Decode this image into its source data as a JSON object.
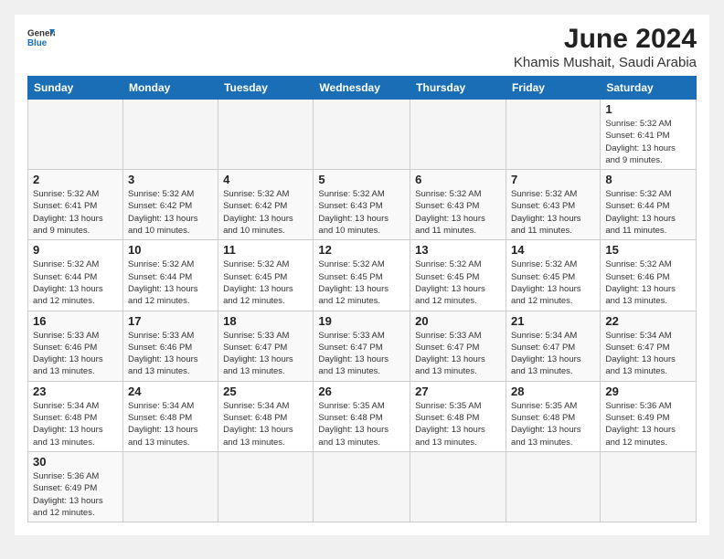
{
  "header": {
    "logo_general": "General",
    "logo_blue": "Blue",
    "month": "June 2024",
    "location": "Khamis Mushait, Saudi Arabia"
  },
  "days_of_week": [
    "Sunday",
    "Monday",
    "Tuesday",
    "Wednesday",
    "Thursday",
    "Friday",
    "Saturday"
  ],
  "weeks": [
    [
      {
        "day": "",
        "info": ""
      },
      {
        "day": "",
        "info": ""
      },
      {
        "day": "",
        "info": ""
      },
      {
        "day": "",
        "info": ""
      },
      {
        "day": "",
        "info": ""
      },
      {
        "day": "",
        "info": ""
      },
      {
        "day": "1",
        "info": "Sunrise: 5:32 AM\nSunset: 6:41 PM\nDaylight: 13 hours\nand 9 minutes."
      }
    ],
    [
      {
        "day": "2",
        "info": "Sunrise: 5:32 AM\nSunset: 6:41 PM\nDaylight: 13 hours\nand 9 minutes."
      },
      {
        "day": "3",
        "info": "Sunrise: 5:32 AM\nSunset: 6:42 PM\nDaylight: 13 hours\nand 10 minutes."
      },
      {
        "day": "4",
        "info": "Sunrise: 5:32 AM\nSunset: 6:42 PM\nDaylight: 13 hours\nand 10 minutes."
      },
      {
        "day": "5",
        "info": "Sunrise: 5:32 AM\nSunset: 6:43 PM\nDaylight: 13 hours\nand 10 minutes."
      },
      {
        "day": "6",
        "info": "Sunrise: 5:32 AM\nSunset: 6:43 PM\nDaylight: 13 hours\nand 11 minutes."
      },
      {
        "day": "7",
        "info": "Sunrise: 5:32 AM\nSunset: 6:43 PM\nDaylight: 13 hours\nand 11 minutes."
      },
      {
        "day": "8",
        "info": "Sunrise: 5:32 AM\nSunset: 6:44 PM\nDaylight: 13 hours\nand 11 minutes."
      }
    ],
    [
      {
        "day": "9",
        "info": "Sunrise: 5:32 AM\nSunset: 6:44 PM\nDaylight: 13 hours\nand 12 minutes."
      },
      {
        "day": "10",
        "info": "Sunrise: 5:32 AM\nSunset: 6:44 PM\nDaylight: 13 hours\nand 12 minutes."
      },
      {
        "day": "11",
        "info": "Sunrise: 5:32 AM\nSunset: 6:45 PM\nDaylight: 13 hours\nand 12 minutes."
      },
      {
        "day": "12",
        "info": "Sunrise: 5:32 AM\nSunset: 6:45 PM\nDaylight: 13 hours\nand 12 minutes."
      },
      {
        "day": "13",
        "info": "Sunrise: 5:32 AM\nSunset: 6:45 PM\nDaylight: 13 hours\nand 12 minutes."
      },
      {
        "day": "14",
        "info": "Sunrise: 5:32 AM\nSunset: 6:45 PM\nDaylight: 13 hours\nand 12 minutes."
      },
      {
        "day": "15",
        "info": "Sunrise: 5:32 AM\nSunset: 6:46 PM\nDaylight: 13 hours\nand 13 minutes."
      }
    ],
    [
      {
        "day": "16",
        "info": "Sunrise: 5:33 AM\nSunset: 6:46 PM\nDaylight: 13 hours\nand 13 minutes."
      },
      {
        "day": "17",
        "info": "Sunrise: 5:33 AM\nSunset: 6:46 PM\nDaylight: 13 hours\nand 13 minutes."
      },
      {
        "day": "18",
        "info": "Sunrise: 5:33 AM\nSunset: 6:47 PM\nDaylight: 13 hours\nand 13 minutes."
      },
      {
        "day": "19",
        "info": "Sunrise: 5:33 AM\nSunset: 6:47 PM\nDaylight: 13 hours\nand 13 minutes."
      },
      {
        "day": "20",
        "info": "Sunrise: 5:33 AM\nSunset: 6:47 PM\nDaylight: 13 hours\nand 13 minutes."
      },
      {
        "day": "21",
        "info": "Sunrise: 5:34 AM\nSunset: 6:47 PM\nDaylight: 13 hours\nand 13 minutes."
      },
      {
        "day": "22",
        "info": "Sunrise: 5:34 AM\nSunset: 6:47 PM\nDaylight: 13 hours\nand 13 minutes."
      }
    ],
    [
      {
        "day": "23",
        "info": "Sunrise: 5:34 AM\nSunset: 6:48 PM\nDaylight: 13 hours\nand 13 minutes."
      },
      {
        "day": "24",
        "info": "Sunrise: 5:34 AM\nSunset: 6:48 PM\nDaylight: 13 hours\nand 13 minutes."
      },
      {
        "day": "25",
        "info": "Sunrise: 5:34 AM\nSunset: 6:48 PM\nDaylight: 13 hours\nand 13 minutes."
      },
      {
        "day": "26",
        "info": "Sunrise: 5:35 AM\nSunset: 6:48 PM\nDaylight: 13 hours\nand 13 minutes."
      },
      {
        "day": "27",
        "info": "Sunrise: 5:35 AM\nSunset: 6:48 PM\nDaylight: 13 hours\nand 13 minutes."
      },
      {
        "day": "28",
        "info": "Sunrise: 5:35 AM\nSunset: 6:48 PM\nDaylight: 13 hours\nand 13 minutes."
      },
      {
        "day": "29",
        "info": "Sunrise: 5:36 AM\nSunset: 6:49 PM\nDaylight: 13 hours\nand 12 minutes."
      }
    ],
    [
      {
        "day": "30",
        "info": "Sunrise: 5:36 AM\nSunset: 6:49 PM\nDaylight: 13 hours\nand 12 minutes."
      },
      {
        "day": "",
        "info": ""
      },
      {
        "day": "",
        "info": ""
      },
      {
        "day": "",
        "info": ""
      },
      {
        "day": "",
        "info": ""
      },
      {
        "day": "",
        "info": ""
      },
      {
        "day": "",
        "info": ""
      }
    ]
  ]
}
